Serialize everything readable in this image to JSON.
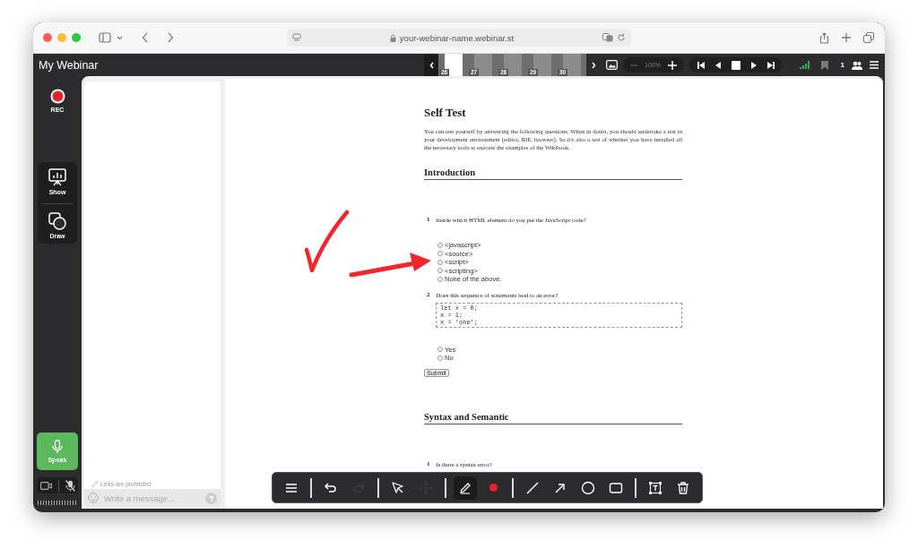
{
  "browser": {
    "url": "your-webinar-name.webinar.st"
  },
  "app": {
    "title": "My Webinar",
    "slides": [
      {
        "number": "26",
        "selected": true
      },
      {
        "number": "27",
        "selected": false
      },
      {
        "number": "28",
        "selected": false
      },
      {
        "number": "29",
        "selected": false
      },
      {
        "number": "30",
        "selected": false
      }
    ],
    "zoom": "100%",
    "participants": "1"
  },
  "rail": {
    "rec": "REC",
    "tools": [
      {
        "kind": "show",
        "label": "Show"
      },
      {
        "kind": "draw",
        "label": "Draw"
      }
    ],
    "speak": "Speak"
  },
  "chat": {
    "notice": "Links are prohibited",
    "placeholder": "Write a message..."
  },
  "document": {
    "title": "Self Test",
    "intro": "You can test yourself by answering the following questions. When in doubt, you should undertake a test in your development environment (editor, IDE, browser). So it's also a test of whether you have installed all the necessary tools to execute the examples of the Wikibook.",
    "sections": [
      {
        "heading": "Introduction",
        "questions": [
          {
            "number": "1",
            "text": "Inside which HTML element do you put the JavaScript code?",
            "options": [
              {
                "label": "<javascript>",
                "selected": false
              },
              {
                "label": "<source>",
                "selected": false
              },
              {
                "label": "<script>",
                "selected": false
              },
              {
                "label": "<scripting>",
                "selected": false
              },
              {
                "label": "None of the above.",
                "selected": false
              }
            ]
          },
          {
            "number": "2",
            "text": "Does this sequence of statements lead to an error?",
            "code": [
              "let x = 0;",
              "x = 1;",
              "x = 'one';"
            ],
            "options": [
              {
                "label": "Yes",
                "selected": false
              },
              {
                "label": "No",
                "selected": false
              }
            ]
          }
        ],
        "submit": "Submit"
      },
      {
        "heading": "Syntax and Semantic",
        "questions": [
          {
            "number": "1",
            "text": "Is there a syntax error?"
          }
        ]
      }
    ]
  },
  "annotations": [
    {
      "kind": "checkmark"
    },
    {
      "kind": "arrow"
    }
  ],
  "toolbar": {
    "groups": [
      {
        "tools": [
          {
            "kind": "menu",
            "selected": false,
            "disabled": false
          }
        ]
      },
      {
        "tools": [
          {
            "kind": "undo",
            "selected": false,
            "disabled": false
          },
          {
            "kind": "redo",
            "selected": false,
            "disabled": true
          }
        ]
      },
      {
        "tools": [
          {
            "kind": "select",
            "selected": false,
            "disabled": false
          },
          {
            "kind": "move",
            "selected": false,
            "disabled": true
          }
        ]
      },
      {
        "tools": [
          {
            "kind": "pencil",
            "selected": true,
            "disabled": false
          },
          {
            "kind": "color",
            "color": "#e8232a",
            "selected": false,
            "disabled": false
          }
        ]
      },
      {
        "tools": [
          {
            "kind": "line",
            "selected": false,
            "disabled": false
          },
          {
            "kind": "arrow",
            "selected": false,
            "disabled": false
          },
          {
            "kind": "circle",
            "selected": false,
            "disabled": false
          },
          {
            "kind": "rectangle",
            "selected": false,
            "disabled": false
          }
        ]
      },
      {
        "tools": [
          {
            "kind": "text",
            "selected": false,
            "disabled": false
          },
          {
            "kind": "trash",
            "selected": false,
            "disabled": false
          }
        ]
      }
    ]
  }
}
